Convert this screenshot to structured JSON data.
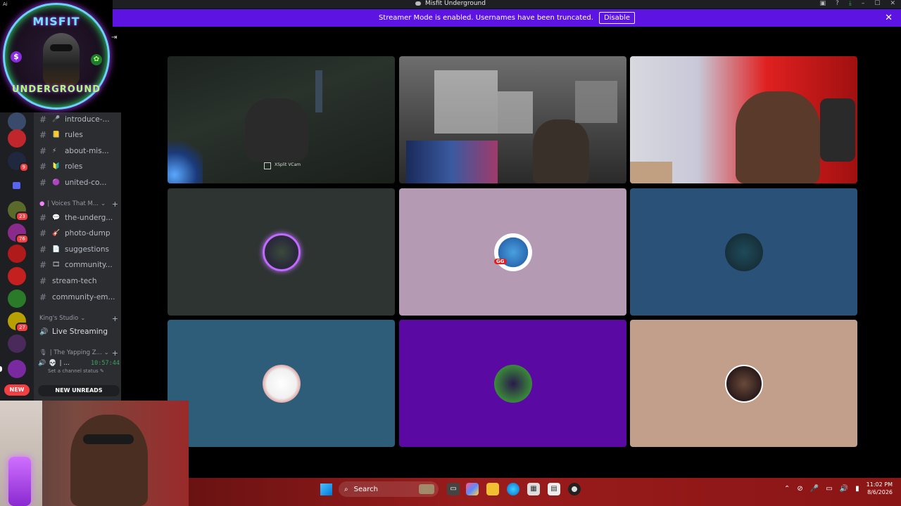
{
  "window": {
    "title": "Misfit Underground"
  },
  "overlay": {
    "small_label": "Ai",
    "logo_top": "MISFIT",
    "logo_bottom": "UNDERGROUND"
  },
  "banner": {
    "message": "Streamer Mode is enabled. Usernames have been truncated.",
    "disable_label": "Disable"
  },
  "servers": {
    "badges": [
      "9",
      "23",
      "76",
      "27"
    ],
    "new_label": "NEW"
  },
  "channels": {
    "items": [
      {
        "label": "introduce-...",
        "emoji": "🎤"
      },
      {
        "label": "rules",
        "emoji": "📒"
      },
      {
        "label": "about-mis...",
        "emoji": "⚡"
      },
      {
        "label": "roles",
        "emoji": "🔰"
      },
      {
        "label": "united-co...",
        "emoji": "🟣"
      }
    ],
    "category_voices": "| Voices That M...",
    "items2": [
      {
        "label": "the-underg...",
        "emoji": "💬"
      },
      {
        "label": "photo-dump",
        "emoji": "🎸"
      },
      {
        "label": "suggestions",
        "emoji": "📄"
      },
      {
        "label": "community...",
        "emoji": "🎞"
      },
      {
        "label": "stream-tech",
        "emoji": ""
      },
      {
        "label": "community-em...",
        "emoji": ""
      }
    ],
    "category_kings": "King's Studio",
    "live_streaming": "Live Streaming",
    "category_yapping": "| The Yapping Z...",
    "voice_user": "| ...",
    "voice_timer": "10:57:44",
    "channel_status": "Set a channel status",
    "new_unreads": "NEW UNREADS"
  },
  "tiles": {
    "cam_label": "XSplit VCam",
    "colors": [
      "#1f2321",
      "#1d231f",
      "#2a2a2a",
      "#2d3431",
      "#b49ab3",
      "#2a5278",
      "#2d5d78",
      "#5a0aa3",
      "#c29f8b"
    ]
  },
  "taskbar": {
    "search_placeholder": "Search",
    "time": "11:02 PM",
    "date": "8/6/2026"
  }
}
